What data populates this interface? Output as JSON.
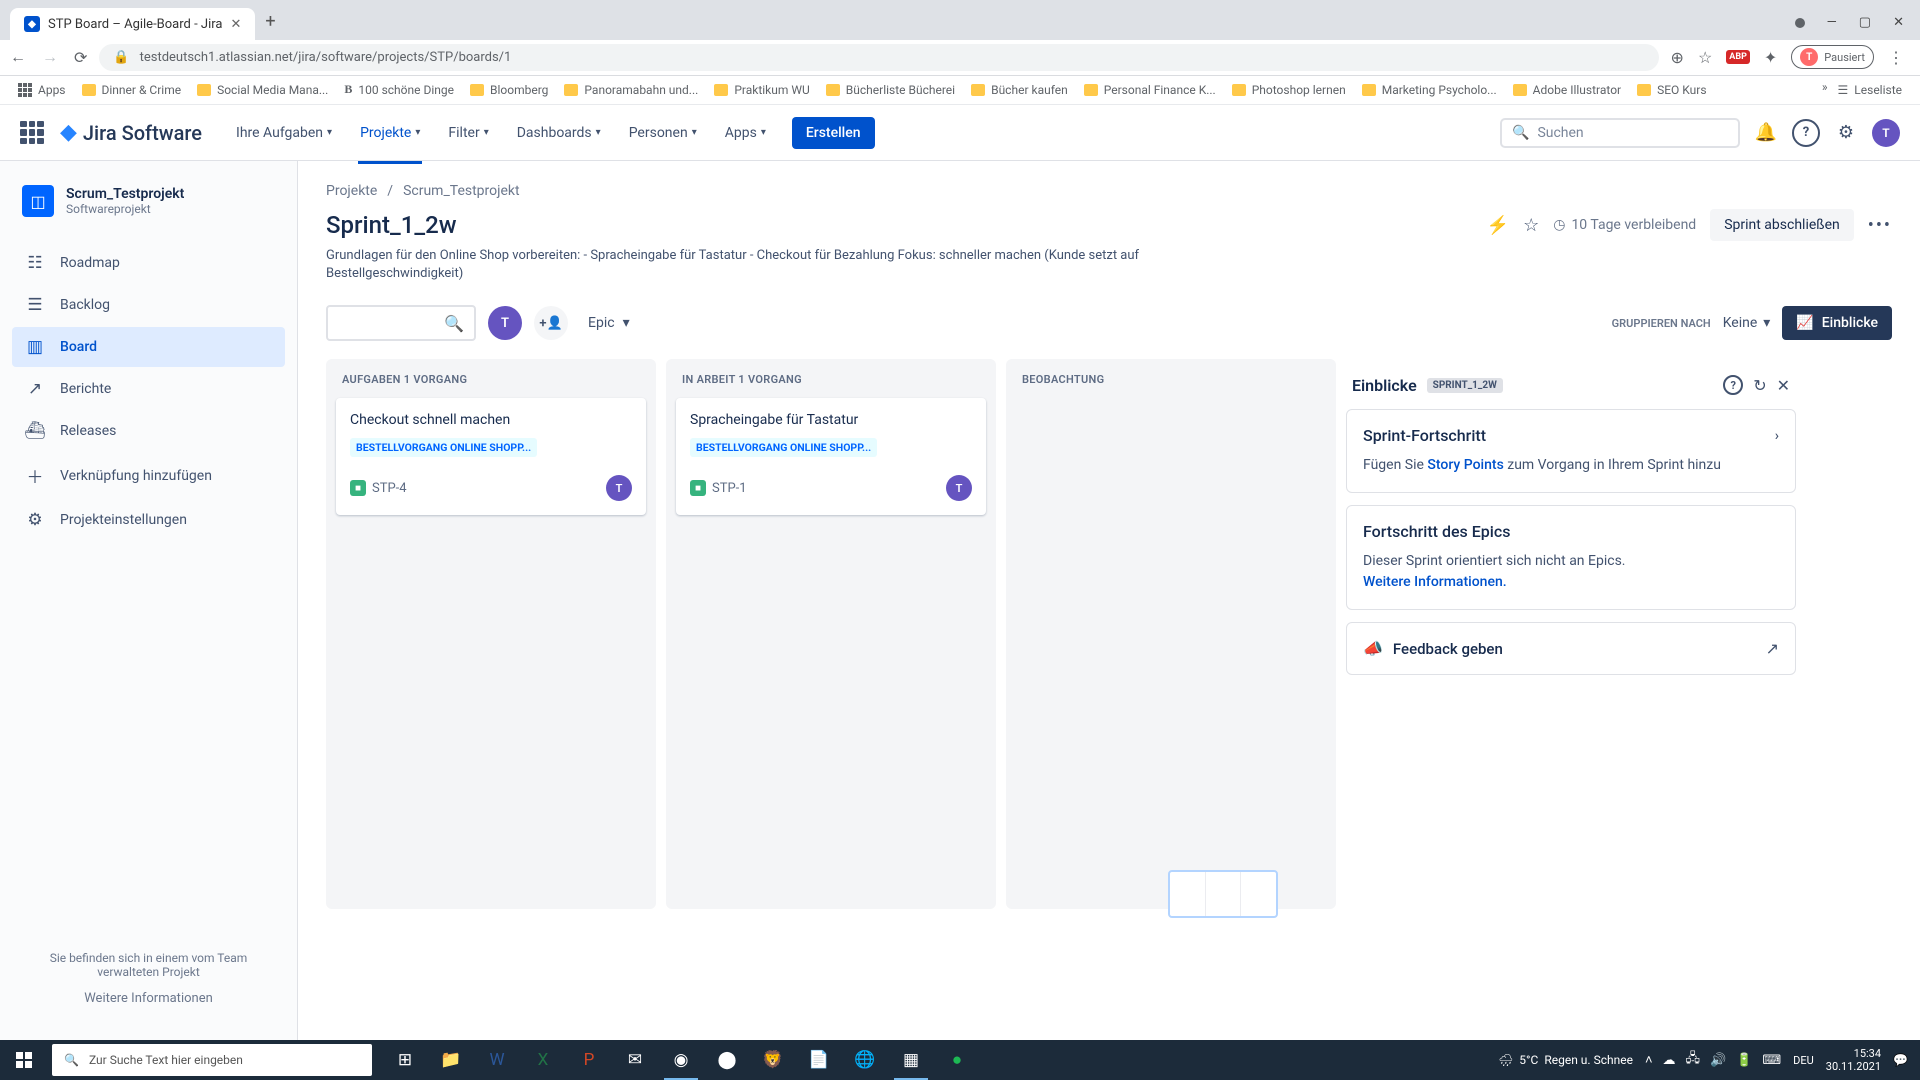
{
  "browser": {
    "tab_title": "STP Board – Agile-Board - Jira",
    "url": "testdeutsch1.atlassian.net/jira/software/projects/STP/boards/1",
    "paused": "Pausiert",
    "bookmarks": [
      "Apps",
      "Dinner & Crime",
      "Social Media Mana...",
      "100 schöne Dinge",
      "Bloomberg",
      "Panoramabahn und...",
      "Praktikum WU",
      "Bücherliste Bücherei",
      "Bücher kaufen",
      "Personal Finance K...",
      "Photoshop lernen",
      "Marketing Psycholo...",
      "Adobe Illustrator",
      "SEO Kurs"
    ],
    "reading_list": "Leseliste"
  },
  "nav": {
    "logo": "Jira Software",
    "items": [
      "Ihre Aufgaben",
      "Projekte",
      "Filter",
      "Dashboards",
      "Personen",
      "Apps"
    ],
    "create": "Erstellen",
    "search_placeholder": "Suchen"
  },
  "sidebar": {
    "project_name": "Scrum_Testprojekt",
    "project_type": "Softwareprojekt",
    "items": [
      {
        "label": "Roadmap",
        "icon": "☷"
      },
      {
        "label": "Backlog",
        "icon": "☰"
      },
      {
        "label": "Board",
        "icon": "▥"
      },
      {
        "label": "Berichte",
        "icon": "↗"
      },
      {
        "label": "Releases",
        "icon": "⛴"
      },
      {
        "label": "Verknüpfung hinzufügen",
        "icon": "＋"
      },
      {
        "label": "Projekteinstellungen",
        "icon": "⚙"
      }
    ],
    "footer1": "Sie befinden sich in einem vom Team verwalteten Projekt",
    "footer2": "Weitere Informationen"
  },
  "page": {
    "breadcrumb": [
      "Projekte",
      "Scrum_Testprojekt"
    ],
    "title": "Sprint_1_2w",
    "remaining": "10 Tage verbleibend",
    "close_sprint": "Sprint abschließen",
    "description": "Grundlagen für den Online Shop vorbereiten: - Spracheingabe für Tastatur - Checkout für Bezahlung Fokus: schneller machen (Kunde setzt auf Bestellgeschwindigkeit)",
    "epic_label": "Epic",
    "group_label": "GRUPPIEREN NACH",
    "group_value": "Keine",
    "insights_btn": "Einblicke"
  },
  "columns": [
    {
      "name": "AUFGABEN 1 VORGANG",
      "cards": [
        {
          "title": "Checkout schnell machen",
          "epic": "BESTELLVORGANG ONLINE SHOPP...",
          "key": "STP-4",
          "assignee": "T"
        }
      ]
    },
    {
      "name": "IN ARBEIT 1 VORGANG",
      "cards": [
        {
          "title": "Spracheingabe für Tastatur",
          "epic": "BESTELLVORGANG ONLINE SHOPP...",
          "key": "STP-1",
          "assignee": "T"
        }
      ]
    },
    {
      "name": "BEOBACHTUNG",
      "cards": []
    }
  ],
  "insights": {
    "title": "Einblicke",
    "badge": "SPRINT_1_2W",
    "progress_title": "Sprint-Fortschritt",
    "progress_text1": "Fügen Sie",
    "progress_link": "Story Points",
    "progress_text2": "zum Vorgang in Ihrem Sprint hinzu",
    "epic_title": "Fortschritt des Epics",
    "epic_text": "Dieser Sprint orientiert sich nicht an Epics.",
    "epic_link": "Weitere Informationen.",
    "feedback": "Feedback geben"
  },
  "taskbar": {
    "search": "Zur Suche Text hier eingeben",
    "weather_temp": "5°C",
    "weather_text": "Regen u. Schnee",
    "lang": "DEU",
    "time": "15:34",
    "date": "30.11.2021"
  }
}
